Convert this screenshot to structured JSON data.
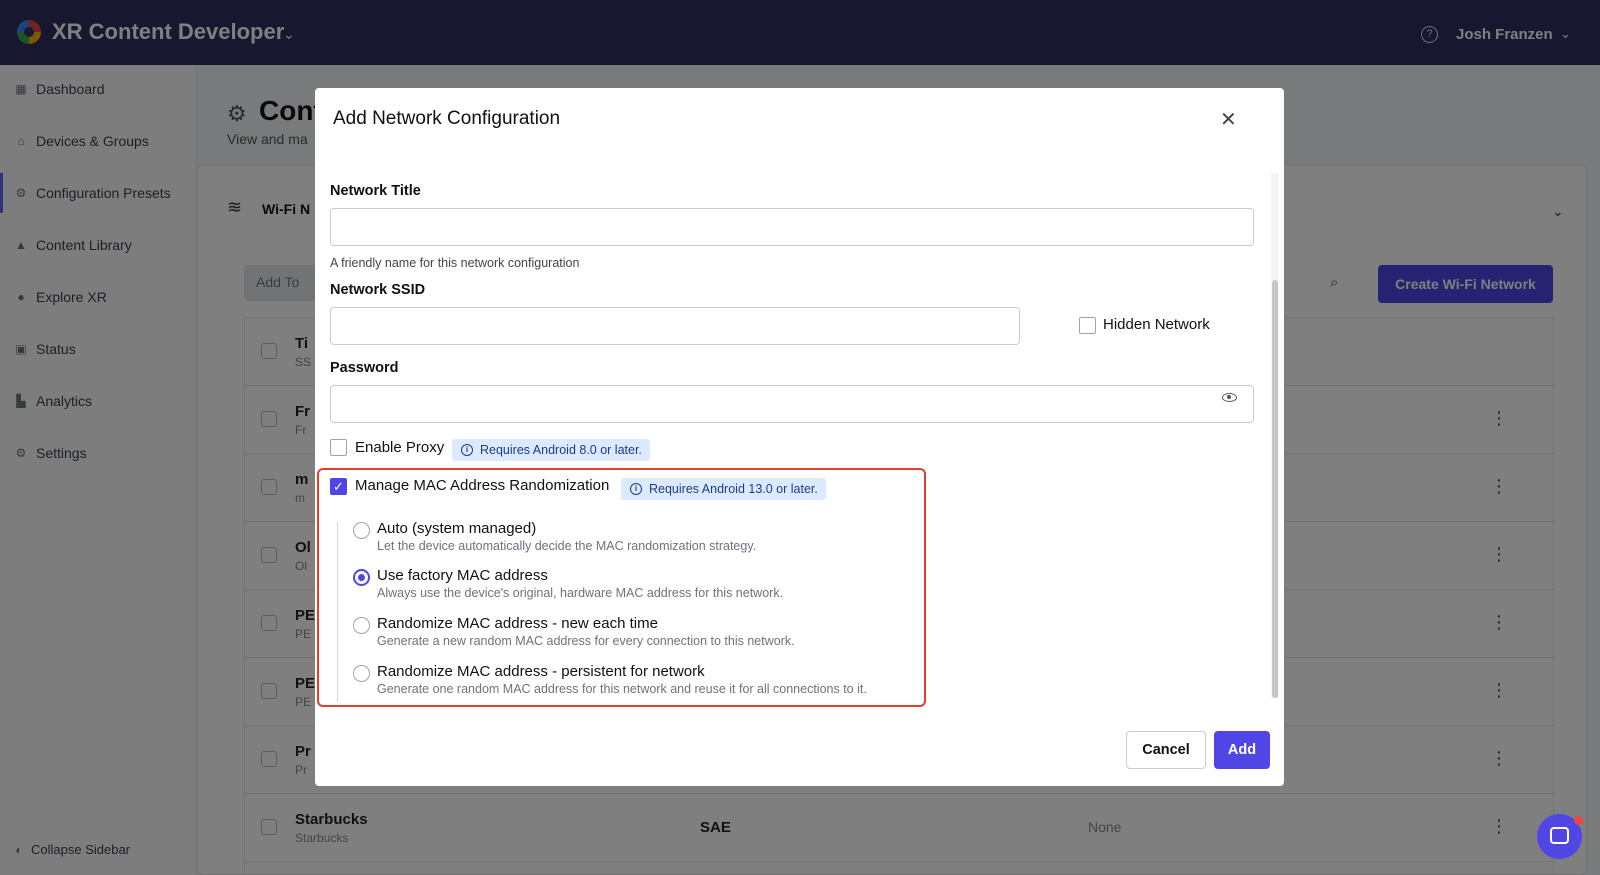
{
  "header": {
    "app_title": "XR Content Developer",
    "user_name": "Josh Franzen"
  },
  "sidebar": {
    "items": [
      {
        "label": "Dashboard",
        "icon": "grid-icon"
      },
      {
        "label": "Devices & Groups",
        "icon": "devices-icon"
      },
      {
        "label": "Configuration Presets",
        "icon": "gear-icon"
      },
      {
        "label": "Content Library",
        "icon": "library-icon"
      },
      {
        "label": "Explore XR",
        "icon": "compass-icon"
      },
      {
        "label": "Status",
        "icon": "status-icon"
      },
      {
        "label": "Analytics",
        "icon": "analytics-icon"
      },
      {
        "label": "Settings",
        "icon": "gear-icon"
      }
    ],
    "collapse_label": "Collapse Sidebar"
  },
  "page": {
    "title": "Conf",
    "subtitle": "View and ma",
    "card_header": "Wi-Fi N",
    "bulk_button": "Add To",
    "create_button": "Create Wi-Fi Network",
    "rows": [
      {
        "title": "Ti",
        "sub": "SS",
        "security": "",
        "proxy": ""
      },
      {
        "title": "Fr",
        "sub": "Fr",
        "security": "",
        "proxy": ""
      },
      {
        "title": "m",
        "sub": "m",
        "security": "",
        "proxy": ""
      },
      {
        "title": "Ol",
        "sub": "Ol",
        "security": "",
        "proxy": ""
      },
      {
        "title": "PE",
        "sub": "PE",
        "security": "",
        "proxy": ""
      },
      {
        "title": "PE",
        "sub": "PE",
        "security": "",
        "proxy": ""
      },
      {
        "title": "Pr",
        "sub": "Pr",
        "security": "",
        "proxy": ""
      },
      {
        "title": "Starbucks",
        "sub": "Starbucks",
        "security": "SAE",
        "proxy": "None"
      }
    ]
  },
  "modal": {
    "title": "Add Network Configuration",
    "network_title": {
      "label": "Network Title",
      "value": "",
      "hint": "A friendly name for this network configuration"
    },
    "network_ssid": {
      "label": "Network SSID",
      "value": "",
      "hidden_label": "Hidden Network",
      "hidden_checked": false
    },
    "password": {
      "label": "Password",
      "value": ""
    },
    "proxy": {
      "label": "Enable Proxy",
      "checked": false,
      "requirement": "Requires Android 8.0 or later."
    },
    "mac": {
      "label": "Manage MAC Address Randomization",
      "checked": true,
      "requirement": "Requires Android 13.0 or later.",
      "options": [
        {
          "title": "Auto (system managed)",
          "desc": "Let the device automatically decide the MAC randomization strategy.",
          "selected": false
        },
        {
          "title": "Use factory MAC address",
          "desc": "Always use the device's original, hardware MAC address for this network.",
          "selected": true
        },
        {
          "title": "Randomize MAC address - new each time",
          "desc": "Generate a new random MAC address for every connection to this network.",
          "selected": false
        },
        {
          "title": "Randomize MAC address - persistent for network",
          "desc": "Generate one random MAC address for this network and reuse it for all connections to it.",
          "selected": false
        }
      ]
    },
    "cancel_label": "Cancel",
    "add_label": "Add"
  },
  "colors": {
    "topbar": "#2f3160",
    "accent": "#4f46e5",
    "highlight_border": "#e53e2e",
    "tag_bg": "#dbeafe"
  }
}
